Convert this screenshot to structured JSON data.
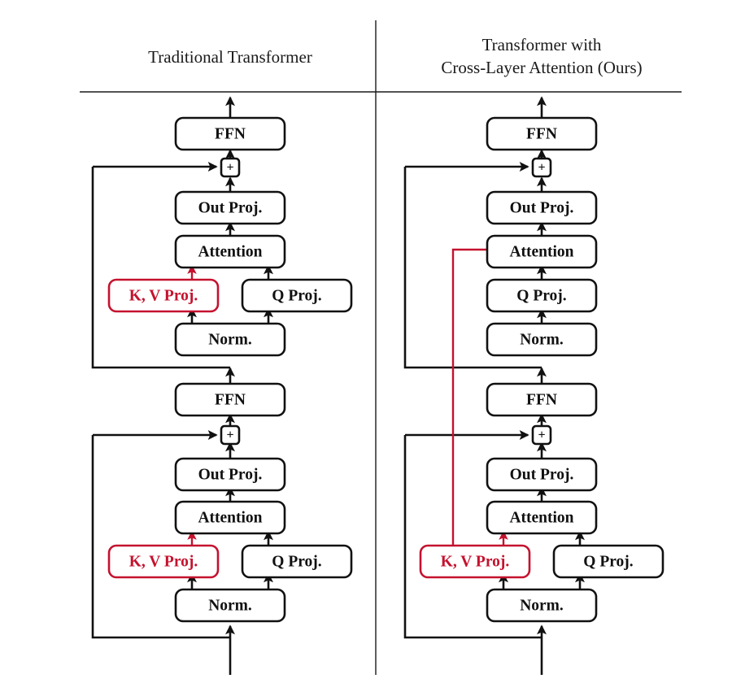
{
  "figure": {
    "title_left": "Traditional Transformer",
    "title_right_line1": "Transformer with",
    "title_right_line2": "Cross-Layer Attention (Ours)",
    "accent_red": "#c4122e",
    "line_black": "#111111",
    "background": "#ffffff"
  },
  "labels": {
    "ffn": "FFN",
    "plus": "+",
    "out_proj": "Out Proj.",
    "attention": "Attention",
    "kv_proj": "K, V Proj.",
    "q_proj": "Q Proj.",
    "norm": "Norm."
  },
  "left_panel": {
    "name": "Traditional Transformer",
    "upper_layer": {
      "ffn": "FFN",
      "residual_add": "+",
      "out_proj": "Out Proj.",
      "attention": "Attention",
      "kv_proj": "K, V Proj.",
      "q_proj": "Q Proj.",
      "norm": "Norm."
    },
    "middle": {
      "ffn": "FFN"
    },
    "lower_layer": {
      "residual_add": "+",
      "out_proj": "Out Proj.",
      "attention": "Attention",
      "kv_proj": "K, V Proj.",
      "q_proj": "Q Proj.",
      "norm": "Norm."
    }
  },
  "right_panel": {
    "name": "Transformer with Cross-Layer Attention (Ours)",
    "upper_layer": {
      "ffn": "FFN",
      "residual_add": "+",
      "out_proj": "Out Proj.",
      "attention": "Attention",
      "q_proj": "Q Proj.",
      "norm": "Norm."
    },
    "middle": {
      "ffn": "FFN"
    },
    "lower_layer": {
      "residual_add": "+",
      "out_proj": "Out Proj.",
      "attention": "Attention",
      "kv_proj": "K, V Proj.",
      "q_proj": "Q Proj.",
      "norm": "Norm."
    },
    "cross_layer_edge": "K, V Proj. shared upward to upper Attention"
  }
}
